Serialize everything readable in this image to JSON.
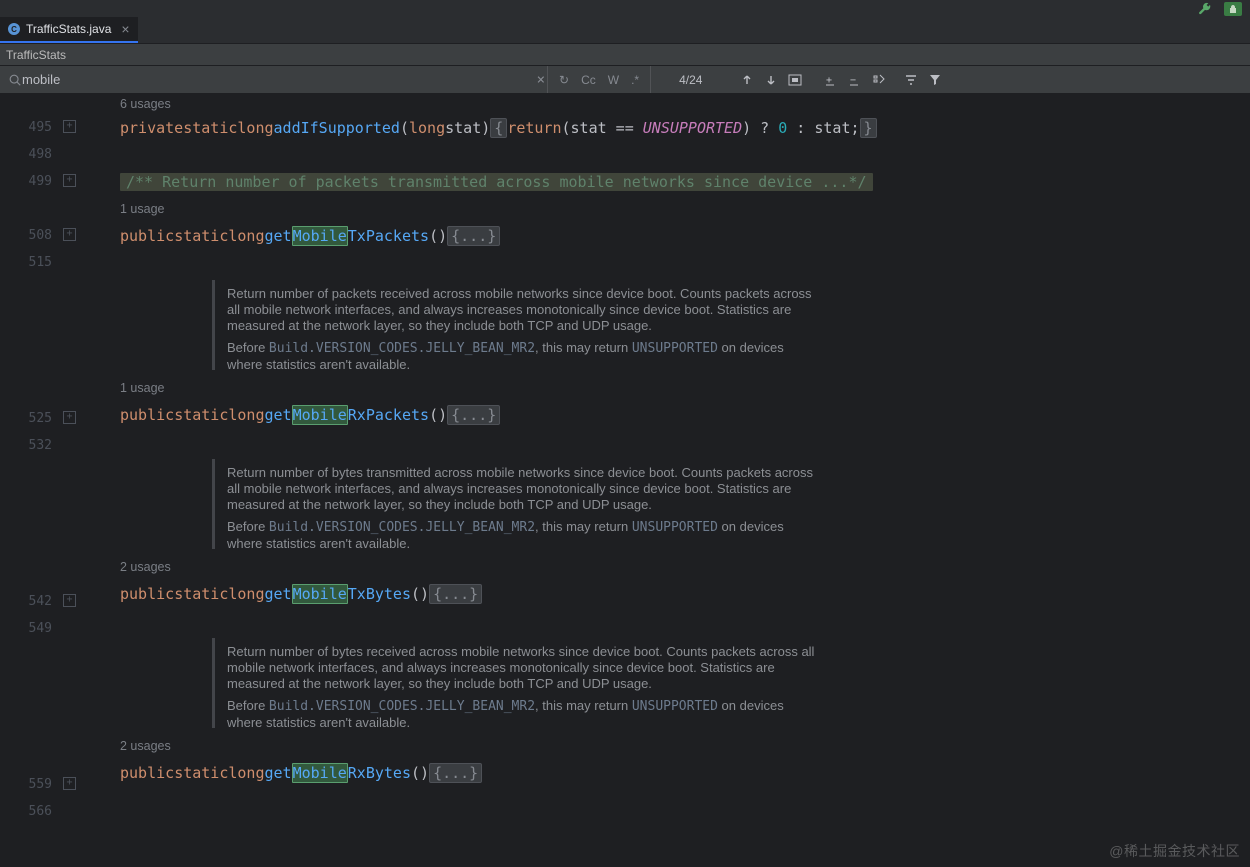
{
  "tabs": [
    {
      "label": "TrafficStats.java"
    }
  ],
  "breadcrumb": "TrafficStats",
  "search": {
    "value": "mobile",
    "count": "4/24",
    "options": {
      "reload": "↻",
      "case": "Cc",
      "word": "W",
      "regex": ".*"
    }
  },
  "lines": {
    "l495": "495",
    "l498": "498",
    "l499": "499",
    "l508": "508",
    "l515": "515",
    "l525": "525",
    "l532": "532",
    "l542": "542",
    "l549": "549",
    "l559": "559",
    "l566": "566"
  },
  "usages": {
    "u6": "6 usages",
    "u1a": "1 usage",
    "u1b": "1 usage",
    "u2a": "2 usages",
    "u2b": "2 usages"
  },
  "code": {
    "addIfSupported": {
      "kw1": "private",
      "kw2": "static",
      "kw3": "long",
      "name": "addIfSupported",
      "p_kw": "long",
      "p_name": "stat",
      "ret": "return",
      "expr_l": "(stat == ",
      "unsupported": "UNSUPPORTED",
      "expr_r": ") ? ",
      "zero": "0",
      "tern": " : stat",
      "semi": ";"
    },
    "docline": "/** Return number of packets transmitted across mobile networks since device ...*/",
    "sig": {
      "kw1": "public",
      "kw2": "static",
      "kw3": "long",
      "pre": "get",
      "hl": "Mobile",
      "txPackets": "TxPackets",
      "rxPackets": "RxPackets",
      "txBytes": "TxBytes",
      "rxBytes": "RxBytes",
      "paren": "()",
      "fold": "{...}"
    },
    "jd": {
      "rxPackets": "Return number of packets received across mobile networks since device boot. Counts packets across all mobile network interfaces, and always increases monotonically since device boot. Statistics are measured at the network layer, so they include both TCP and UDP usage.",
      "txBytes": "Return number of bytes transmitted across mobile networks since device boot. Counts packets across all mobile network interfaces, and always increases monotonically since device boot. Statistics are measured at the network layer, so they include both TCP and UDP usage.",
      "rxBytes": "Return number of bytes received across mobile networks since device boot. Counts packets across all mobile network interfaces, and always increases monotonically since device boot. Statistics are measured at the network layer, so they include both TCP and UDP usage.",
      "before": "Before ",
      "versionCode": "Build.VERSION_CODES.JELLY_BEAN_MR2",
      "mid": ", this may return ",
      "unsupported": "UNSUPPORTED",
      "after": " on devices where statistics aren't available."
    }
  },
  "watermark": "@稀土掘金技术社区"
}
